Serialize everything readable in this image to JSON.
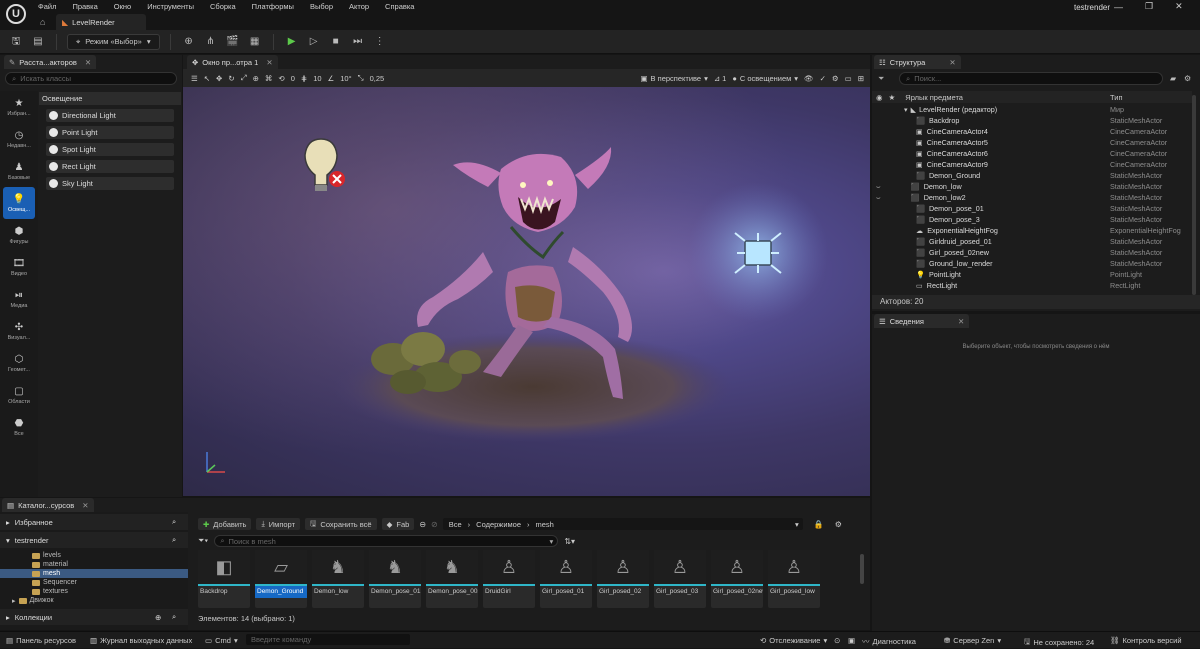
{
  "app": {
    "logo": "ue-logo",
    "project": "testrender",
    "level_tab": "LevelRender"
  },
  "menu": [
    "Файл",
    "Правка",
    "Окно",
    "Инструменты",
    "Сборка",
    "Платформы",
    "Выбор",
    "Актор",
    "Справка"
  ],
  "toolbar": {
    "mode": "Режим «Выбор»"
  },
  "place_actors": {
    "tab": "Расста...акторов",
    "search_placeholder": "Искать классы",
    "categories": [
      {
        "label": "Избран...",
        "icon": "star-icon"
      },
      {
        "label": "Недавн...",
        "icon": "clock-icon"
      },
      {
        "label": "Базовые",
        "icon": "shapes-icon"
      },
      {
        "label": "Освещ...",
        "icon": "bulb-icon",
        "active": true
      },
      {
        "label": "Фигуры",
        "icon": "cube-icon"
      },
      {
        "label": "Видео",
        "icon": "film-icon"
      },
      {
        "label": "Медиа",
        "icon": "media-icon"
      },
      {
        "label": "Визуал...",
        "icon": "visual-icon"
      },
      {
        "label": "Геомет...",
        "icon": "geometry-icon"
      },
      {
        "label": "Области",
        "icon": "volume-icon"
      },
      {
        "label": "Все",
        "icon": "all-icon"
      }
    ],
    "section": "Освещение",
    "items": [
      "Directional Light",
      "Point Light",
      "Spot Light",
      "Rect Light",
      "Sky Light"
    ]
  },
  "viewport": {
    "tab": "Окно пр...отра 1",
    "rot_snap": "0",
    "grid": "10",
    "angle": "10°",
    "scale": "0,25",
    "perspective": "В перспективе",
    "lit": "С освещением",
    "count": "1"
  },
  "outliner": {
    "tab": "Структура",
    "search_placeholder": "Поиск...",
    "col_label": "Ярлык предмета",
    "col_type": "Тип",
    "root": {
      "name": "LevelRender (редактор)",
      "type": "Мир"
    },
    "rows": [
      {
        "name": "Backdrop",
        "type": "StaticMeshActor"
      },
      {
        "name": "CineCameraActor4",
        "type": "CineCameraActor"
      },
      {
        "name": "CineCameraActor5",
        "type": "CineCameraActor"
      },
      {
        "name": "CineCameraActor6",
        "type": "CineCameraActor"
      },
      {
        "name": "CineCameraActor9",
        "type": "CineCameraActor"
      },
      {
        "name": "Demon_Ground",
        "type": "StaticMeshActor"
      },
      {
        "name": "Demon_low",
        "type": "StaticMeshActor"
      },
      {
        "name": "Demon_low2",
        "type": "StaticMeshActor"
      },
      {
        "name": "Demon_pose_01",
        "type": "StaticMeshActor"
      },
      {
        "name": "Demon_pose_3",
        "type": "StaticMeshActor"
      },
      {
        "name": "ExponentialHeightFog",
        "type": "ExponentialHeightFog"
      },
      {
        "name": "Girldruid_posed_01",
        "type": "StaticMeshActor"
      },
      {
        "name": "Girl_posed_02new",
        "type": "StaticMeshActor"
      },
      {
        "name": "Ground_low_render",
        "type": "StaticMeshActor"
      },
      {
        "name": "PointLight",
        "type": "PointLight"
      },
      {
        "name": "RectLight",
        "type": "RectLight"
      }
    ],
    "actor_count": "Акторов: 20"
  },
  "details": {
    "tab": "Сведения",
    "hint": "Выберите объект, чтобы посмотреть сведения о нём"
  },
  "content_browser": {
    "tab": "Каталог...сурсов",
    "favorites": "Избранное",
    "project": "testrender",
    "folders": [
      "levels",
      "material",
      "mesh",
      "Sequencer",
      "textures"
    ],
    "engine": "Движок",
    "collections": "Коллекции",
    "add": "Добавить",
    "import": "Импорт",
    "save_all": "Сохранить всё",
    "fab": "Fab",
    "path": [
      "Все",
      "Содержимое",
      "mesh"
    ],
    "search_placeholder": "Поиск в mesh",
    "assets": [
      {
        "name": "Backdrop"
      },
      {
        "name": "Demon_Ground",
        "selected": true
      },
      {
        "name": "Demon_low"
      },
      {
        "name": "Demon_pose_01"
      },
      {
        "name": "Demon_pose_002"
      },
      {
        "name": "DruidGirl"
      },
      {
        "name": "Girl_posed_01"
      },
      {
        "name": "Girl_posed_02"
      },
      {
        "name": "Girl_posed_03"
      },
      {
        "name": "Girl_posed_02new"
      },
      {
        "name": "Girl_posed_low"
      }
    ],
    "count": "Элементов: 14 (выбрано: 1)"
  },
  "status": {
    "content_drawer": "Панель ресурсов",
    "output_log": "Журнал выходных данных",
    "cmd": "Cmd",
    "cmd_placeholder": "Введите команду",
    "tracking": "Отслеживание",
    "diagnostics": "Диагностика",
    "zen": "Сервер Zen",
    "unsaved": "Не сохранено: 24",
    "revision": "Контроль версий"
  },
  "colors": {
    "accent": "#1669c5",
    "play": "#5cc94a",
    "folder": "#c6a253",
    "asset_bar": "#2fb6c8"
  }
}
